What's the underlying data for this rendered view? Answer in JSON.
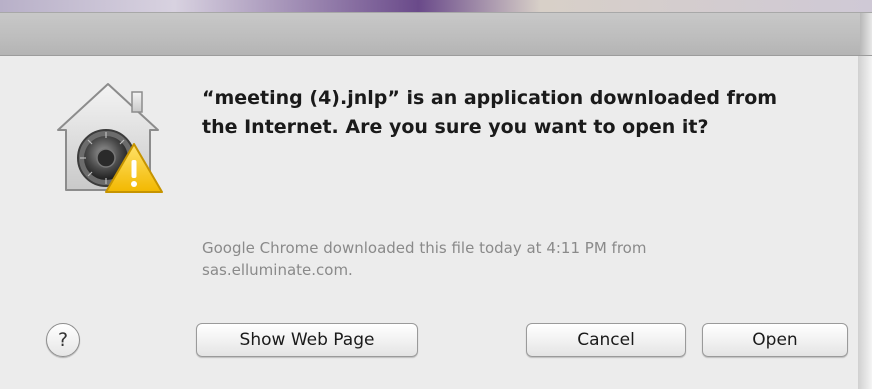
{
  "dialog": {
    "headline": "“meeting (4).jnlp” is an application downloaded from the Internet. Are you sure you want to open it?",
    "info": "Google Chrome downloaded this file today at 4:11 PM from sas.elluminate.com.",
    "icon": "gatekeeper-security-icon",
    "help_label": "?",
    "buttons": {
      "show_web_page": "Show Web Page",
      "cancel": "Cancel",
      "open": "Open"
    }
  },
  "colors": {
    "dialog_background": "#ececec",
    "info_text": "#8a8a8a",
    "warning_yellow": "#f5c400"
  }
}
